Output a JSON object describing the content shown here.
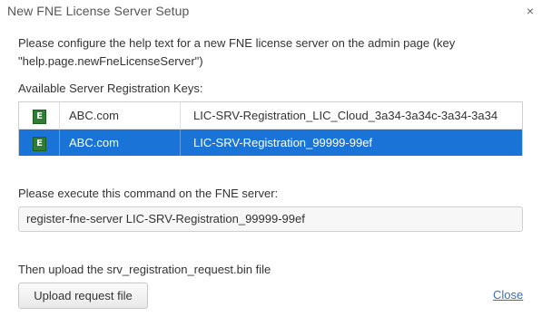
{
  "dialog": {
    "title": "New FNE License Server Setup",
    "close_symbol": "×",
    "intro_line1": "Please configure the help text for a new FNE license server on the admin page (key",
    "intro_line2": "\"help.page.newFneLicenseServer\")"
  },
  "keys": {
    "label": "Available Server Registration Keys:",
    "rows": [
      {
        "icon": "E",
        "org": "ABC.com",
        "key": "LIC-SRV-Registration_LIC_Cloud_3a34-3a34c-3a34-3a34",
        "selected": false
      },
      {
        "icon": "E",
        "org": "ABC.com",
        "key": "LIC-SRV-Registration_99999-99ef",
        "selected": true
      }
    ]
  },
  "command": {
    "label": "Please execute this command on the FNE server:",
    "value": "register-fne-server LIC-SRV-Registration_99999-99ef"
  },
  "upload": {
    "label": "Then upload the srv_registration_request.bin file",
    "button_label": "Upload request file"
  },
  "footer": {
    "close_label": "Close"
  },
  "colors": {
    "selection": "#1a73d6",
    "entitlement_icon": "#2e7d32",
    "link": "#3a6fb0"
  }
}
